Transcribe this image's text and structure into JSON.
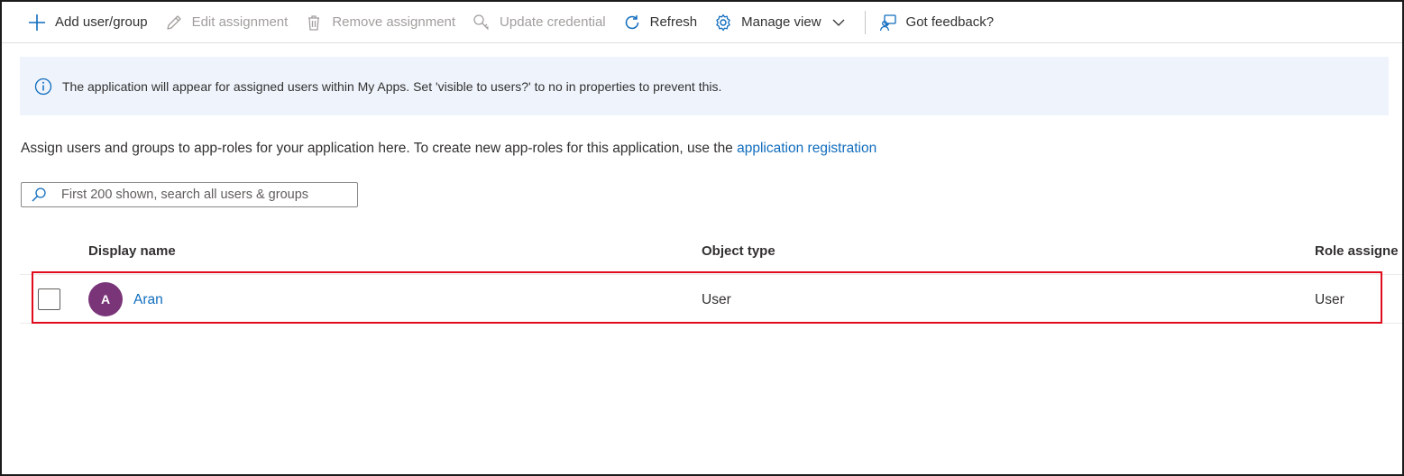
{
  "toolbar": {
    "add": "Add user/group",
    "edit": "Edit assignment",
    "remove": "Remove assignment",
    "update_credential": "Update credential",
    "refresh": "Refresh",
    "manage_view": "Manage view",
    "feedback": "Got feedback?"
  },
  "banner": {
    "text": "The application will appear for assigned users within My Apps. Set 'visible to users?' to no in properties to prevent this."
  },
  "description": {
    "text": "Assign users and groups to app-roles for your application here. To create new app-roles for this application, use the ",
    "link": "application registration"
  },
  "search": {
    "placeholder": "First 200 shown, search all users & groups"
  },
  "table": {
    "columns": [
      "Display name",
      "Object type",
      "Role assigned"
    ],
    "visible_column_3_text": "Role assigne",
    "rows": [
      {
        "avatar_initial": "A",
        "display_name": "Aran",
        "object_type": "User",
        "role": "User"
      }
    ]
  },
  "colors": {
    "accent": "#0f6cbd",
    "avatar_bg": "#7a3579",
    "highlight": "#e00b1c",
    "banner_bg": "#eff4fc"
  },
  "icons": [
    "plus-icon",
    "pencil-icon",
    "trash-icon",
    "key-search-icon",
    "refresh-icon",
    "gear-icon",
    "chevron-down-icon",
    "feedback-icon",
    "info-icon",
    "search-icon"
  ]
}
